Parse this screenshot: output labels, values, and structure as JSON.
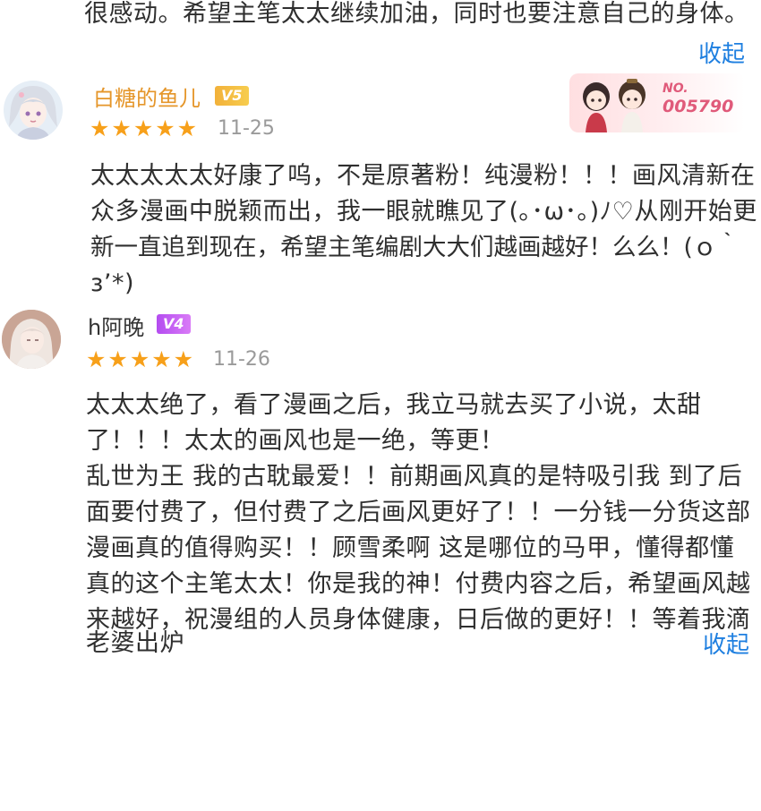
{
  "top_comment": {
    "last_line": "很感动。希望主笔太太继续加油，同时也要注意自己的身体。",
    "collapse_label": "收起"
  },
  "comments": [
    {
      "username": "白糖的鱼儿",
      "vip_level": "V5",
      "stars": "★★★★★",
      "rating": 5,
      "date": "11-25",
      "badge_label": "NO.",
      "badge_number": "005790",
      "lines": [
        "太太太太太好康了呜，不是原著粉！纯漫粉！！！画风清新在",
        "众多漫画中脱颖而出，我一眼就瞧见了(｡･ω･｡)ﾉ♡从刚开始更",
        "新一直追到现在，希望主笔编剧大大们越画越好！么么！(ｏ｀",
        "з’*)"
      ]
    },
    {
      "username": "h阿晚",
      "vip_level": "V4",
      "stars": "★★★★★",
      "rating": 5,
      "date": "11-26",
      "lines": [
        "太太太绝了，看了漫画之后，我立马就去买了小说，太甜",
        "了！！！太太的画风也是一绝，等更！",
        "乱世为王 我的古耽最爱！！前期画风真的是特吸引我 到了后",
        "面要付费了，但付费了之后画风更好了！！一分钱一分货这部",
        "漫画真的值得购买！！顾雪柔啊 这是哪位的马甲，懂得都懂",
        "真的这个主笔太太！你是我的神！付费内容之后，希望画风越",
        "来越好，祝漫组的人员身体健康，日后做的更好！！等着我滴",
        "老婆出炉"
      ],
      "collapse_label": "收起"
    }
  ],
  "colors": {
    "link": "#1e7fe0",
    "star": "#f7a01a",
    "username_gold": "#e5962a",
    "vip_gold": "#f2b13a",
    "vip_purple": "#b44cf0"
  }
}
